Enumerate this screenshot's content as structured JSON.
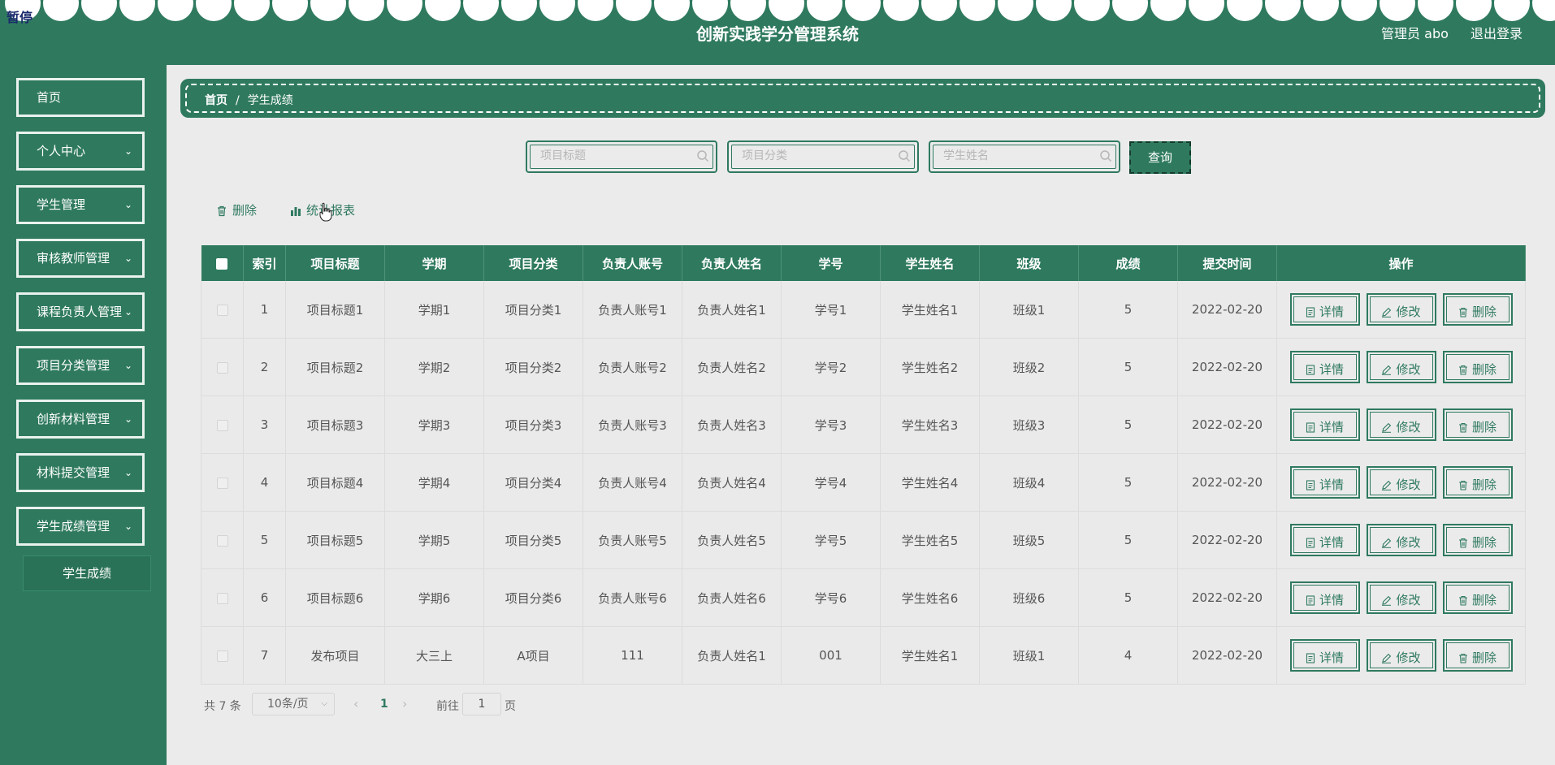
{
  "header": {
    "pause_label": "暂停",
    "title": "创新实践学分管理系统",
    "user": "管理员 abo",
    "logout": "退出登录"
  },
  "sidebar": {
    "items": [
      {
        "label": "首页",
        "has_children": false
      },
      {
        "label": "个人中心",
        "has_children": true
      },
      {
        "label": "学生管理",
        "has_children": true
      },
      {
        "label": "审核教师管理",
        "has_children": true
      },
      {
        "label": "课程负责人管理",
        "has_children": true
      },
      {
        "label": "项目分类管理",
        "has_children": true
      },
      {
        "label": "创新材料管理",
        "has_children": true
      },
      {
        "label": "材料提交管理",
        "has_children": true
      },
      {
        "label": "学生成绩管理",
        "has_children": true
      }
    ],
    "active_sub": "学生成绩"
  },
  "breadcrumb": {
    "home": "首页",
    "separator": "/",
    "current": "学生成绩"
  },
  "search": {
    "title_placeholder": "项目标题",
    "category_placeholder": "项目分类",
    "name_placeholder": "学生姓名",
    "query_label": "查询"
  },
  "actions": {
    "delete": "删除",
    "report": "统计报表"
  },
  "table": {
    "headers": [
      "索引",
      "项目标题",
      "学期",
      "项目分类",
      "负责人账号",
      "负责人姓名",
      "学号",
      "学生姓名",
      "班级",
      "成绩",
      "提交时间",
      "操作"
    ],
    "op_labels": {
      "detail": "详情",
      "edit": "修改",
      "delete": "删除"
    },
    "rows": [
      [
        "1",
        "项目标题1",
        "学期1",
        "项目分类1",
        "负责人账号1",
        "负责人姓名1",
        "学号1",
        "学生姓名1",
        "班级1",
        "5",
        "2022-02-20"
      ],
      [
        "2",
        "项目标题2",
        "学期2",
        "项目分类2",
        "负责人账号2",
        "负责人姓名2",
        "学号2",
        "学生姓名2",
        "班级2",
        "5",
        "2022-02-20"
      ],
      [
        "3",
        "项目标题3",
        "学期3",
        "项目分类3",
        "负责人账号3",
        "负责人姓名3",
        "学号3",
        "学生姓名3",
        "班级3",
        "5",
        "2022-02-20"
      ],
      [
        "4",
        "项目标题4",
        "学期4",
        "项目分类4",
        "负责人账号4",
        "负责人姓名4",
        "学号4",
        "学生姓名4",
        "班级4",
        "5",
        "2022-02-20"
      ],
      [
        "5",
        "项目标题5",
        "学期5",
        "项目分类5",
        "负责人账号5",
        "负责人姓名5",
        "学号5",
        "学生姓名5",
        "班级5",
        "5",
        "2022-02-20"
      ],
      [
        "6",
        "项目标题6",
        "学期6",
        "项目分类6",
        "负责人账号6",
        "负责人姓名6",
        "学号6",
        "学生姓名6",
        "班级6",
        "5",
        "2022-02-20"
      ],
      [
        "7",
        "发布项目",
        "大三上",
        "A项目",
        "111",
        "负责人姓名1",
        "001",
        "学生姓名1",
        "班级1",
        "4",
        "2022-02-20"
      ]
    ]
  },
  "pagination": {
    "total": "共 7 条",
    "page_size": "10条/页",
    "current_page": "1",
    "goto_label": "前往",
    "goto_value": "1",
    "page_unit": "页"
  },
  "colors": {
    "primary": "#2f7a5f",
    "background": "#ebebeb"
  }
}
